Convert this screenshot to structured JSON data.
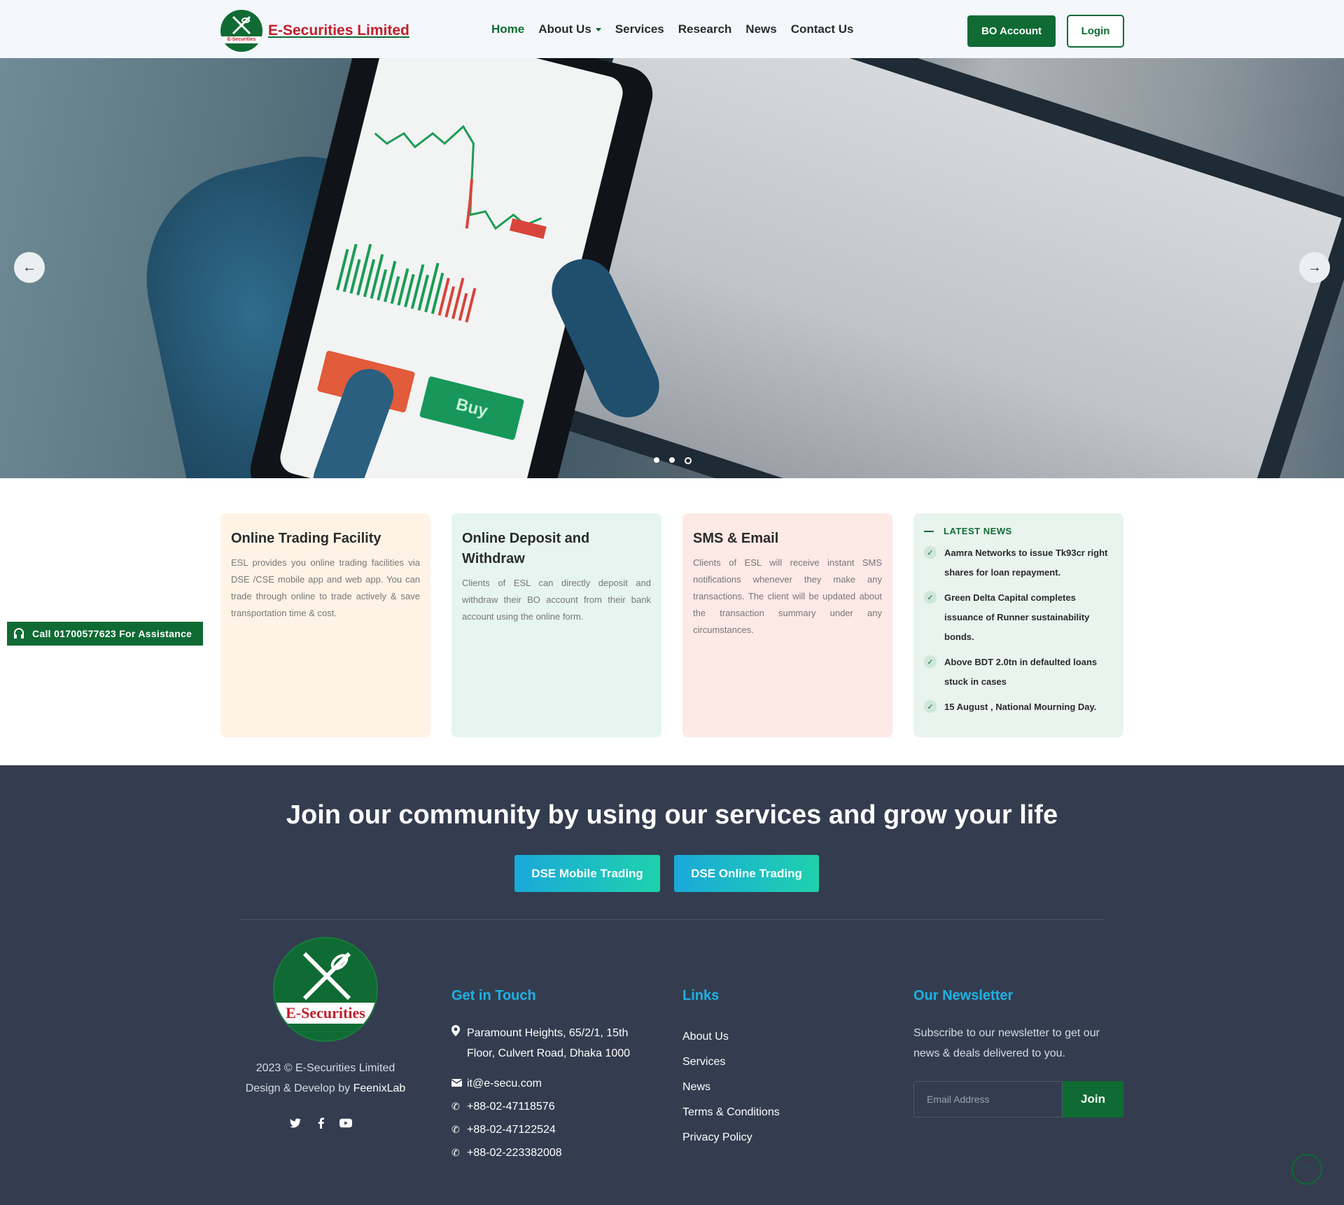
{
  "header": {
    "brand": "E-Securities Limited",
    "logo_badge": "E-Securities",
    "nav": [
      "Home",
      "About Us",
      "Services",
      "Research",
      "News",
      "Contact Us"
    ],
    "bo_account": "BO Account",
    "login": "Login"
  },
  "hero": {
    "buy_label": "Buy",
    "prev_icon": "arrow-left-icon",
    "next_icon": "arrow-right-icon",
    "slides_count": 3,
    "active_slide": 3
  },
  "cards": [
    {
      "title": "Online Trading Facility",
      "text": "ESL provides you online trading facilities via DSE /CSE mobile app and web app. You can trade through online to trade actively & save transportation time & cost.",
      "bg": "#fff3e6"
    },
    {
      "title": "Online Deposit and Withdraw",
      "text": "Clients of ESL can directly deposit and withdraw their BO account from their bank account using the online form.",
      "bg": "#e6f5ef"
    },
    {
      "title": "SMS & Email",
      "text": "Clients of ESL will receive instant SMS notifications whenever they make any transactions. The client will be updated about the transaction summary under any circumstances.",
      "bg": "#fde9e6"
    }
  ],
  "latest_news": {
    "heading": "LATEST NEWS",
    "items": [
      "Aamra Networks to issue Tk93cr right shares for loan repayment.",
      "Green Delta Capital completes issuance of Runner sustainability bonds.",
      "Above BDT 2.0tn in defaulted loans stuck in cases",
      "15 August , National Mourning Day."
    ]
  },
  "assist": {
    "label": "Call 01700577623 For Assistance"
  },
  "footer": {
    "community_heading": "Join our community by using our services and grow your life",
    "btn_mobile": "DSE Mobile Trading",
    "btn_online": "DSE Online Trading",
    "copyright": "2023 © E-Securities Limited",
    "design_prefix": "Design & Develop by ",
    "design_by": "FeenixLab",
    "logo_badge": "E-Securities",
    "get_in_touch_title": "Get in Touch",
    "address": "Paramount Heights, 65/2/1, 15th Floor, Culvert Road, Dhaka 1000",
    "email": "it@e-secu.com",
    "phones": [
      "+88-02-47118576",
      "+88-02-47122524",
      "+88-02-223382008"
    ],
    "links_title": "Links",
    "links": [
      "About Us",
      "Services",
      "News",
      "Terms & Conditions",
      "Privacy Policy"
    ],
    "newsletter_title": "Our Newsletter",
    "newsletter_text": "Subscribe to our newsletter to get our news & deals delivered to you.",
    "email_placeholder": "Email Address",
    "join": "Join"
  },
  "colors": {
    "brand_green": "#0f6b33",
    "brand_red": "#c0202b",
    "footer_bg": "#333d4f",
    "accent_cyan": "#1eb2e3"
  }
}
